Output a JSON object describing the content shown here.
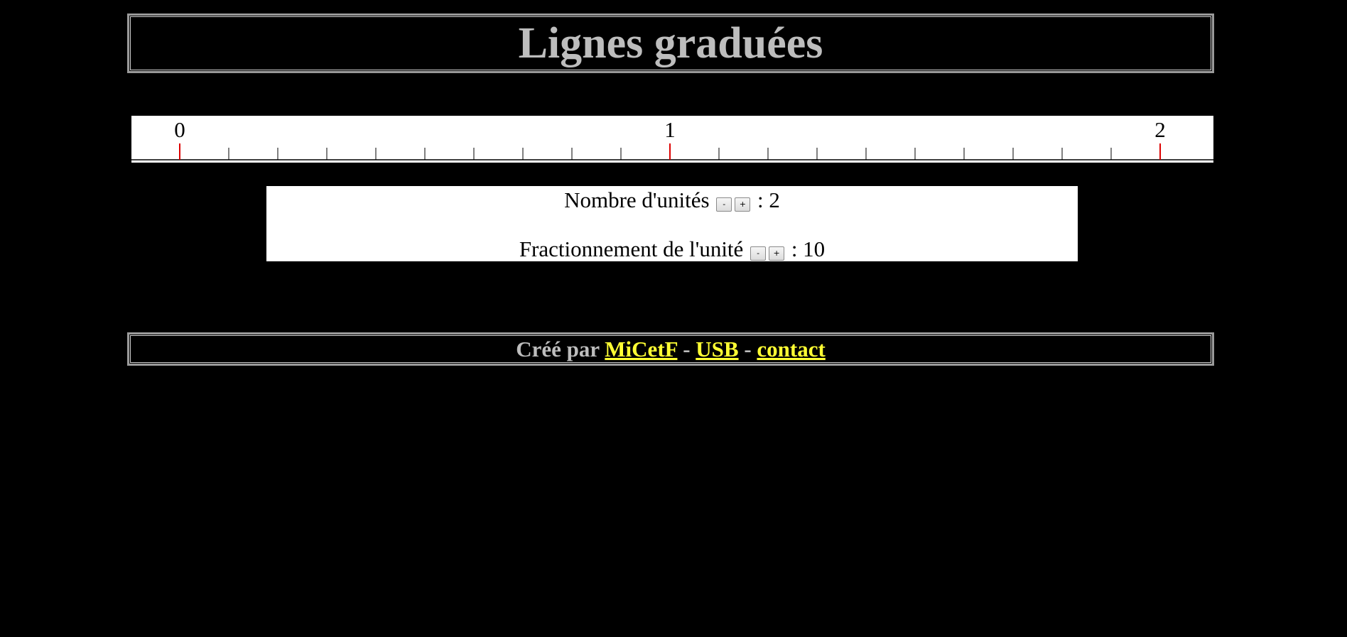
{
  "header": {
    "title": "Lignes graduées"
  },
  "ruler": {
    "units": 2,
    "subdivisions": 10,
    "labels": [
      "0",
      "1",
      "2"
    ],
    "major_tick_color": "#dd0000",
    "minor_tick_color": "#000000"
  },
  "controls": {
    "units_label": "Nombre d'unités",
    "units_minus": "-",
    "units_plus": "+",
    "units_value": ": 2",
    "fraction_label": "Fractionnement de l'unité",
    "fraction_minus": "-",
    "fraction_plus": "+",
    "fraction_value": ": 10"
  },
  "footer": {
    "prefix": "Créé par",
    "link1": "MiCetF",
    "sep1": "-",
    "link2": "USB",
    "sep2": "-",
    "link3": "contact",
    "link_color": "#ffff33"
  }
}
